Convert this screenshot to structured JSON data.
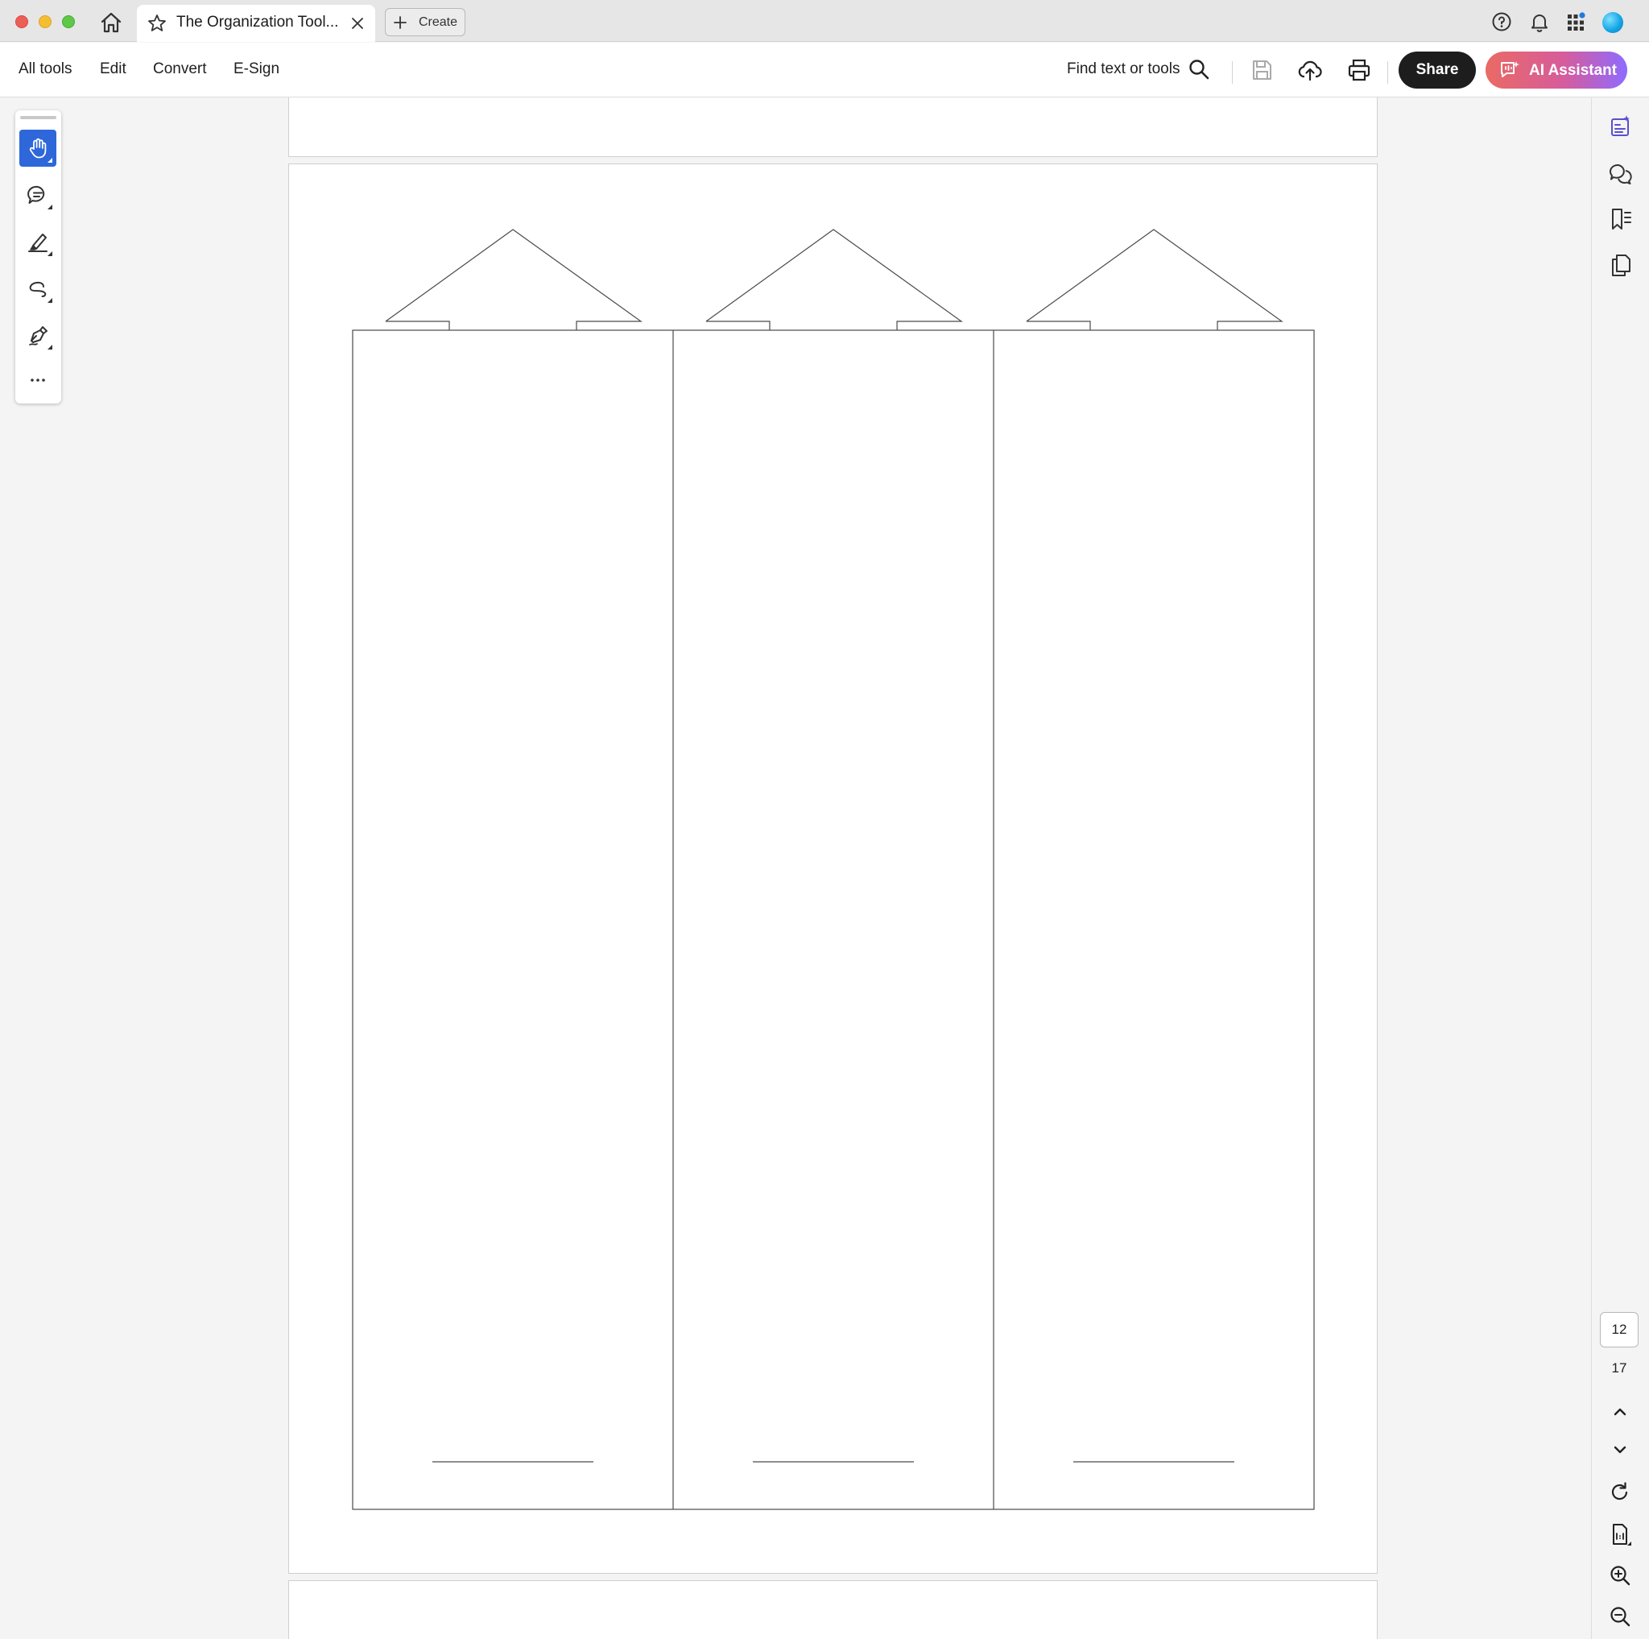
{
  "window": {
    "tab_title": "The Organization Tool...",
    "create_label": "Create"
  },
  "toolbar": {
    "menu": [
      "All tools",
      "Edit",
      "Convert",
      "E-Sign"
    ],
    "find_label": "Find text or tools",
    "share_label": "Share",
    "ai_label": "AI Assistant"
  },
  "tools": [
    "hand-tool",
    "comment-tool",
    "highlight-tool",
    "draw-tool",
    "sign-tool",
    "more-tools"
  ],
  "page_nav": {
    "current_page": "12",
    "total_pages": "17"
  },
  "document": {
    "panel_count": 3
  },
  "colors": {
    "accent": "#2e67d9",
    "share_bg": "#1d1d1d",
    "ai_gradient_start": "#ea6a64",
    "ai_gradient_end": "#8e6bff"
  }
}
